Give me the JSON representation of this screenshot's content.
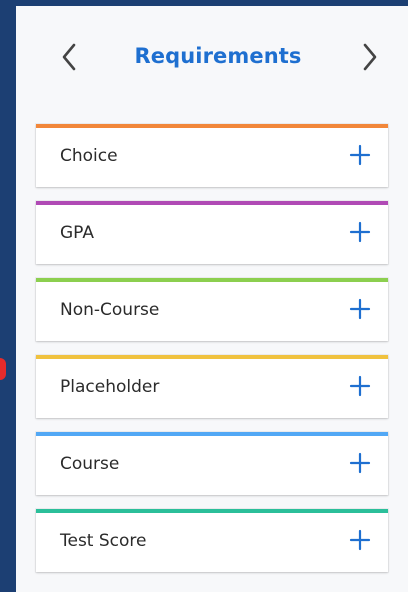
{
  "header": {
    "title": "Requirements",
    "prev_icon": "chevron-left-icon",
    "next_icon": "chevron-right-icon"
  },
  "colors": {
    "background": "#1c3f73",
    "panel": "#f7f8fa",
    "title": "#1e6fd0",
    "plus": "#1e6fd0",
    "marker": "#e52b2b"
  },
  "requirements": [
    {
      "label": "Choice",
      "accent": "#f2873a",
      "icon": "plus-icon"
    },
    {
      "label": "GPA",
      "accent": "#b04ab5",
      "icon": "plus-icon"
    },
    {
      "label": "Non-Course",
      "accent": "#8ccf4f",
      "icon": "plus-icon"
    },
    {
      "label": "Placeholder",
      "accent": "#f0c23e",
      "icon": "plus-icon"
    },
    {
      "label": "Course",
      "accent": "#52a8f5",
      "icon": "plus-icon"
    },
    {
      "label": "Test Score",
      "accent": "#2bbf9a",
      "icon": "plus-icon"
    }
  ]
}
